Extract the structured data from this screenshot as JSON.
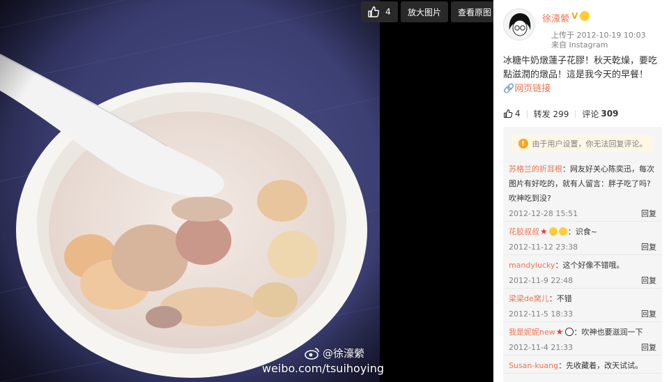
{
  "toolbar": {
    "like_count": "4",
    "enlarge_label": "放大图片",
    "original_label": "查看原图"
  },
  "watermark": {
    "user": "@徐濠縈",
    "url": "weibo.com/tsuihoying"
  },
  "author": {
    "name": "徐濠縈",
    "verified_mark": "V",
    "time": "上传于 2012-10-19 10:03",
    "source": "来自 Instagram"
  },
  "post": {
    "text": "冰糖牛奶燉蓮子花膠！秋天乾燥，要吃點滋潤的燉品！這是我今天的早餐！",
    "link_label": "网页链接"
  },
  "stats": {
    "likes": "4",
    "repost_label": "转发 299",
    "comment_label": "评论",
    "comment_count": "309"
  },
  "notice": "由于用户设置，你无法回复评论。",
  "comments": [
    {
      "user": "苏格兰的折耳根",
      "text": "：网友好关心陈奕迅，每次图片有好吃的，就有人留言：胖子吃了吗?吹神吃到没?",
      "time": "2012-12-28 15:51",
      "reply": "回复"
    },
    {
      "user": "花胶叔叔",
      "text": "：识食~",
      "time": "2012-11-12 23:38",
      "reply": "回复"
    },
    {
      "user": "mandylucky",
      "text": "：这个好像不错哦。",
      "time": "2012-11-9 22:48",
      "reply": "回复"
    },
    {
      "user": "梁梁de窝儿",
      "text": "：不错",
      "time": "2012-11-5 18:33",
      "reply": "回复"
    },
    {
      "user": "我是妮妮new",
      "text": "：吹神也要滋润一下",
      "time": "2012-11-4 21:33",
      "reply": "回复"
    },
    {
      "user": "Susan-kuang",
      "text": "：先收藏着，改天试试。",
      "time": "",
      "reply": ""
    }
  ]
}
